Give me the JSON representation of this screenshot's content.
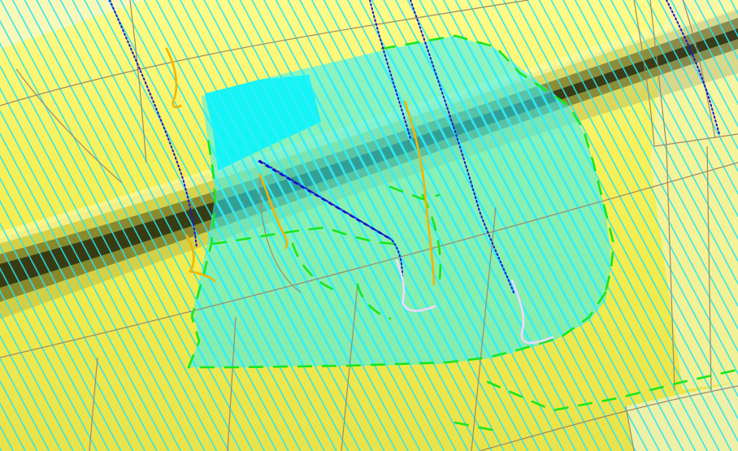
{
  "viewport": {
    "background_color": "#f4f06a",
    "surface_colors": {
      "highlight": "#fffb8a",
      "base": "#f2ec4e",
      "shadow": "#9a9520",
      "deep_shadow": "#2f3512",
      "pale": "#eef0a8"
    },
    "hatch_color": "#23e5f2",
    "hatch_fill_color": "#2ff0ff",
    "edge_color": "#9b8a6a",
    "toolpaths": {
      "dashed_green": "#19e619",
      "dotted_blue": "#1818d6",
      "orange": "#f2b400",
      "lavender": "#f0d8ff"
    }
  }
}
